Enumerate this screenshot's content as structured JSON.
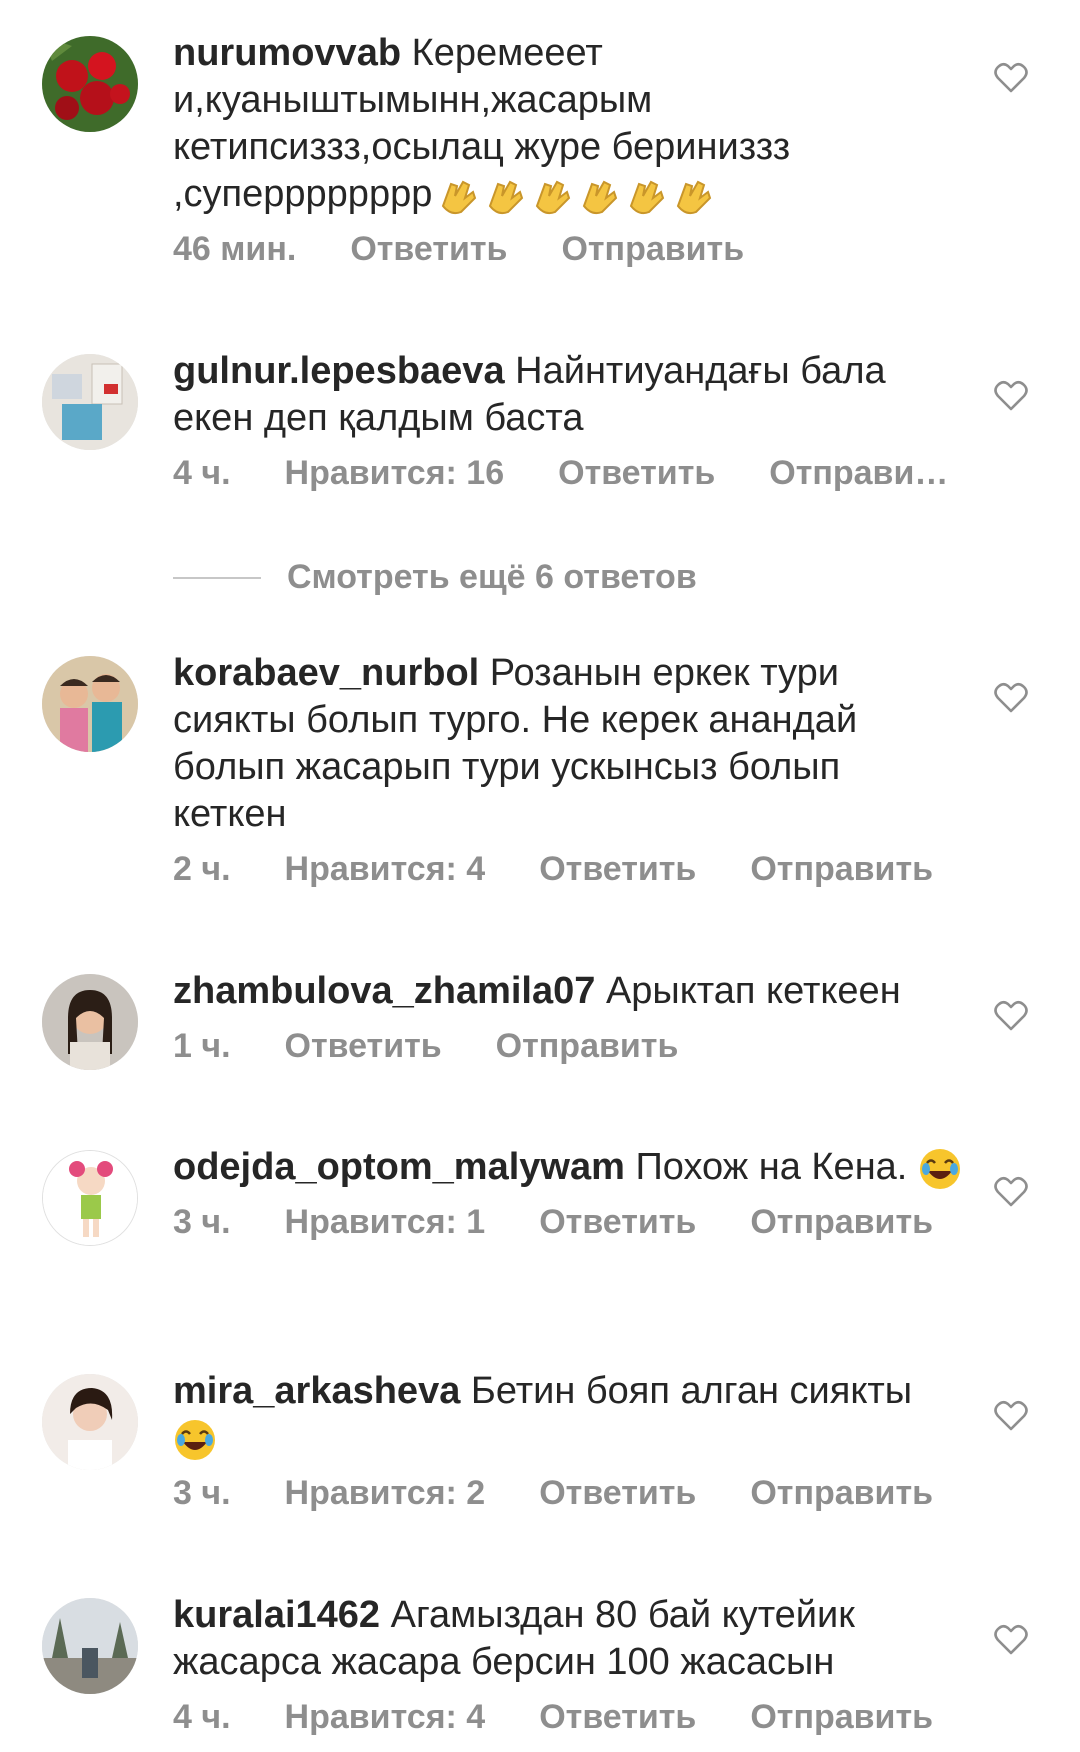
{
  "comments": [
    {
      "username": "nurumovvab",
      "text": "Керемееет и,куаныштымынн,жасарым кетипсиззз,осылац журе бериниззз ,суперррррррр",
      "trailing_emoji": "clapping-hands x6",
      "time": "46 мин.",
      "likes": "",
      "reply": "Ответить",
      "send": "Отправить",
      "avatar": "red-roses-avatar"
    },
    {
      "username": "gulnur.lepesbaeva",
      "text": "Найнтиуандағы бала екен деп қалдым баста",
      "time": "4 ч.",
      "likes": "Нравится: 16",
      "reply": "Ответить",
      "send": "Отправи…",
      "avatar": "room-photo-avatar"
    },
    {
      "username": "korabaev_nurbol",
      "text": "Розанын еркек тури сиякты болып турго. Не керек анандай болып жасарып тури ускынсыз болып кеткен",
      "time": "2 ч.",
      "likes": "Нравится: 4",
      "reply": "Ответить",
      "send": "Отправить",
      "avatar": "children-photo-avatar"
    },
    {
      "username": "zhambulova_zhamila07",
      "text": "Арыктап кеткеен",
      "time": "1 ч.",
      "likes": "",
      "reply": "Ответить",
      "send": "Отправить",
      "avatar": "woman-photo-avatar"
    },
    {
      "username": "odejda_optom_malywam",
      "text": "Похож на Кена.",
      "trailing_emoji": "laughing-face",
      "time": "3 ч.",
      "likes": "Нравится: 1",
      "reply": "Ответить",
      "send": "Отправить",
      "avatar": "doll-avatar"
    },
    {
      "username": "mira_arkasheva",
      "text": "Бетин бояп алган сиякты",
      "trailing_emoji": "laughing-face",
      "time": "3 ч.",
      "likes": "Нравится: 2",
      "reply": "Ответить",
      "send": "Отправить",
      "avatar": "woman-portrait-avatar"
    },
    {
      "username": "kuralai1462",
      "text": "Агамыздан 80 бай кутейик жасарса жасара берсин 100 жасасын",
      "time": "4 ч.",
      "likes": "Нравится: 4",
      "reply": "Ответить",
      "send": "Отправить",
      "avatar": "park-photo-avatar"
    }
  ],
  "more_replies": "Смотреть ещё 6 ответов",
  "colors": {
    "text": "#262626",
    "meta": "#8e8e8e",
    "divider": "#c7c7c7"
  }
}
